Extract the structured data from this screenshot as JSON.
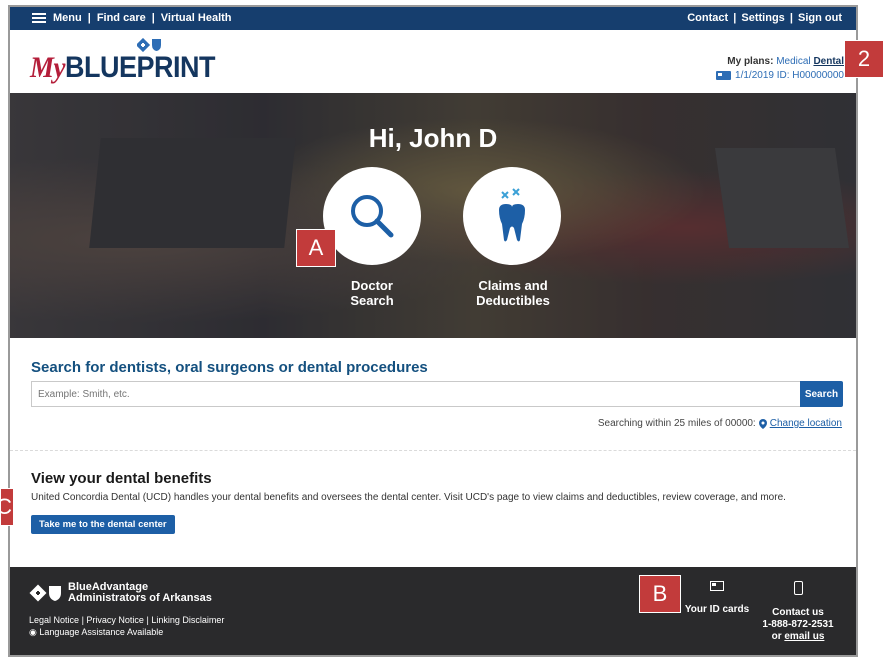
{
  "topbar": {
    "menu": "Menu",
    "find_care": "Find care",
    "virtual_health": "Virtual Health",
    "contact": "Contact",
    "settings": "Settings",
    "sign_out": "Sign out",
    "separator": "|"
  },
  "header": {
    "logo_my": "My",
    "logo_blueprint": "BLUEPRINT",
    "plans_label": "My plans:",
    "plan_medical": "Medical",
    "plan_dental": "Dental",
    "id_line": "1/1/2019 ID: H00000000"
  },
  "hero": {
    "greeting": "Hi, John D",
    "doctor_search_line1": "Doctor",
    "doctor_search_line2": "Search",
    "claims_line1": "Claims and",
    "claims_line2": "Deductibles"
  },
  "markers": {
    "a": "A",
    "b": "B",
    "c": "C",
    "two": "2"
  },
  "search": {
    "title": "Search for dentists, oral surgeons or dental procedures",
    "placeholder": "Example: Smith, etc.",
    "button": "Search",
    "within_text": "Searching within 25 miles of  00000:",
    "change_location": "Change location"
  },
  "benefits": {
    "title": "View your dental benefits",
    "text": "United Concordia Dental (UCD) handles your dental benefits and oversees the dental center. Visit UCD's page to view claims and deductibles, review coverage, and more.",
    "button": "Take me to the dental center"
  },
  "footer": {
    "brand_line1": "BlueAdvantage",
    "brand_line2": "Administrators of Arkansas",
    "legal": "Legal Notice",
    "privacy": "Privacy Notice",
    "linking": "Linking Disclaimer",
    "language": "Language Assistance Available",
    "id_cards": "Your ID cards",
    "contact_us": "Contact us",
    "phone": "1-888-872-2531",
    "or": "or",
    "email_us": "email us"
  },
  "colors": {
    "topbar": "#163e6e",
    "accent_blue": "#1d5fa6",
    "title_blue": "#14507f",
    "marker_red": "#c23b3b",
    "footer": "#2a2a2c"
  }
}
